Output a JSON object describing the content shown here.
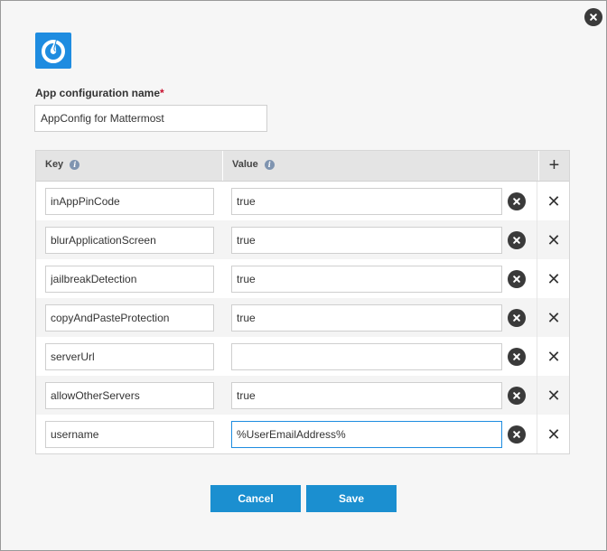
{
  "dialog": {
    "app_name_label": "App configuration name",
    "required_marker": "*",
    "app_name_value": "AppConfig for Mattermost",
    "colors": {
      "accent": "#1b8fd0",
      "logo_bg": "#1e8ce0",
      "required": "#c8102e"
    }
  },
  "table": {
    "key_header": "Key",
    "value_header": "Value",
    "info_icon": "i",
    "add_symbol": "+",
    "delete_symbol": "✕",
    "rows": [
      {
        "key": "inAppPinCode",
        "value": "true"
      },
      {
        "key": "blurApplicationScreen",
        "value": "true"
      },
      {
        "key": "jailbreakDetection",
        "value": "true"
      },
      {
        "key": "copyAndPasteProtection",
        "value": "true"
      },
      {
        "key": "serverUrl",
        "value": ""
      },
      {
        "key": "allowOtherServers",
        "value": "true"
      },
      {
        "key": "username",
        "value": "%UserEmailAddress%"
      }
    ]
  },
  "footer": {
    "cancel_label": "Cancel",
    "save_label": "Save"
  }
}
